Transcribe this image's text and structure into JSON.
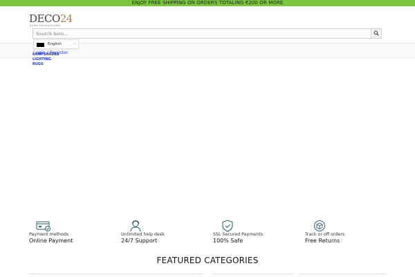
{
  "promo": {
    "text": "ENJOY FREE SHIPPING ON ORDERS TOTALING €200 OR MORE"
  },
  "header": {
    "logo": {
      "main": "DECO",
      "number": "24",
      "tagline": "HOME DECORATIONS"
    },
    "search": {
      "placeholder": "Search here..."
    },
    "language": {
      "label": "English"
    },
    "account": {
      "text": "Login / Register"
    }
  },
  "nav": {
    "items": [
      {
        "label": "LAMPSHADES"
      },
      {
        "label": "LIGHTING"
      },
      {
        "label": "RUGS"
      }
    ]
  },
  "features": [
    {
      "icon": "credit-card-check-icon",
      "small": "Payment methods",
      "big": "Online Payment"
    },
    {
      "icon": "support-agent-icon",
      "small": "Unlimited help desk",
      "big": "24/7 Support"
    },
    {
      "icon": "shield-check-icon",
      "small": "SSL Secured Payments",
      "big": "100% Safe"
    },
    {
      "icon": "box-return-icon",
      "small": "Track or off orders",
      "big": "Free Returns"
    }
  ],
  "featured": {
    "heading": "FEATURED CATEGORIES"
  },
  "colors": {
    "promo_bg": "#7cc63f",
    "nav_link": "#1f37c6",
    "logo_accent": "#b08552"
  }
}
